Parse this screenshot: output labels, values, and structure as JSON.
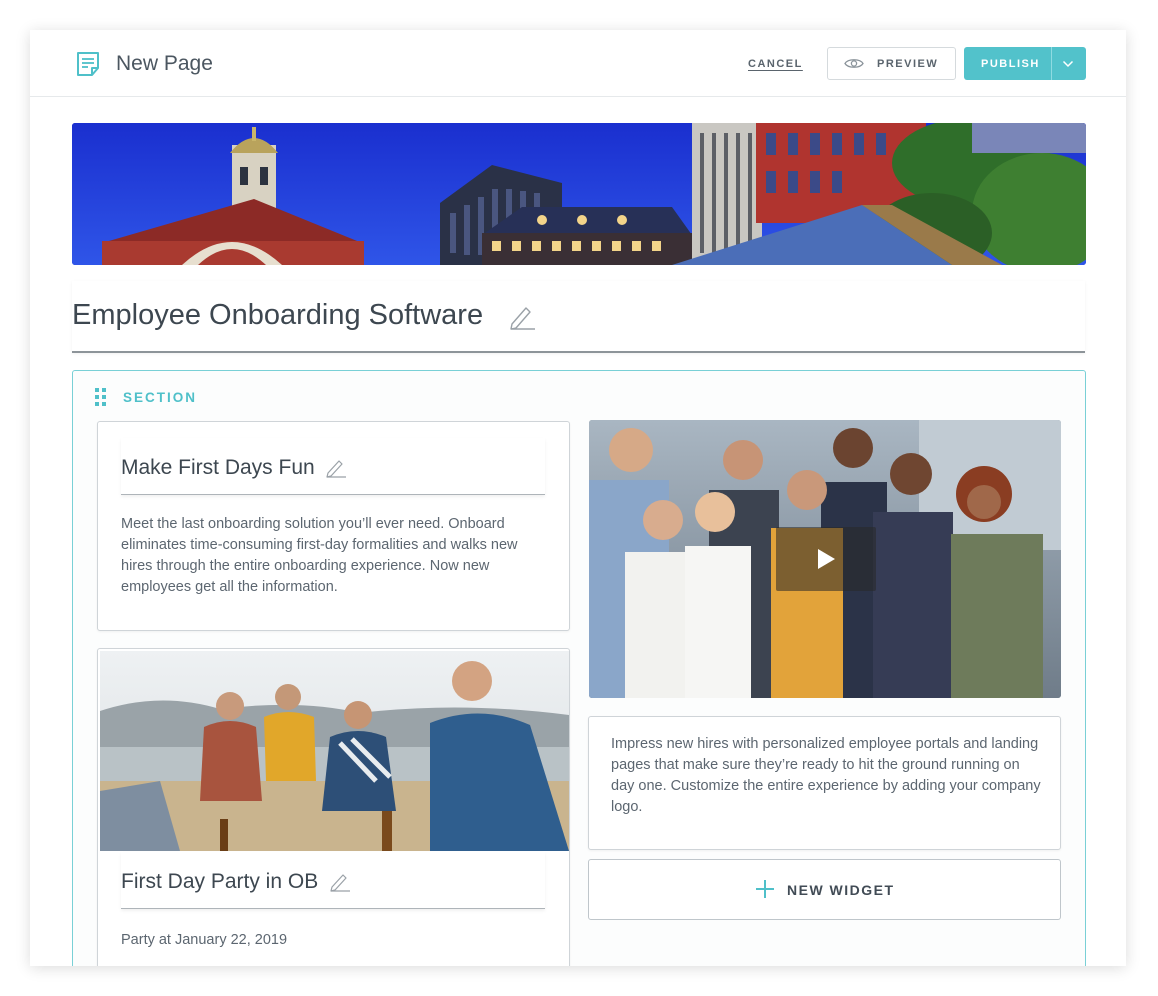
{
  "header": {
    "title": "New Page",
    "cancel_label": "CANCEL",
    "preview_label": "PREVIEW",
    "publish_label": "PUBLISH"
  },
  "page": {
    "title": "Employee Onboarding Software"
  },
  "section": {
    "label": "SECTION",
    "cards": [
      {
        "heading": "Make First Days Fun",
        "lines": [
          "Meet the last onboarding solution you’ll ever need. Onboard",
          "eliminates time-consuming first-day formalities and walks new",
          "hires through the entire onboarding experience. Now new",
          "employees get all the information."
        ]
      },
      {
        "heading": "First Day Party in OB",
        "text": "Party at January 22, 2019"
      },
      {
        "lines": [
          "Impress new hires with personalized employee portals and landing",
          "pages that make sure they’re ready to hit the ground running on",
          "day one. Customize the entire experience by adding your company",
          "logo."
        ]
      }
    ],
    "new_widget_label": "NEW WIDGET"
  },
  "icons": {
    "page": "page-icon",
    "preview": "eye-icon",
    "publish_menu": "chevron-down-icon",
    "edit": "pencil-icon",
    "drag": "drag-handle-icon",
    "play": "play-icon",
    "add": "plus-icon"
  },
  "colors": {
    "accent": "#52c2cb",
    "section_border": "#79d0d6",
    "text_dark": "#3d4750"
  }
}
